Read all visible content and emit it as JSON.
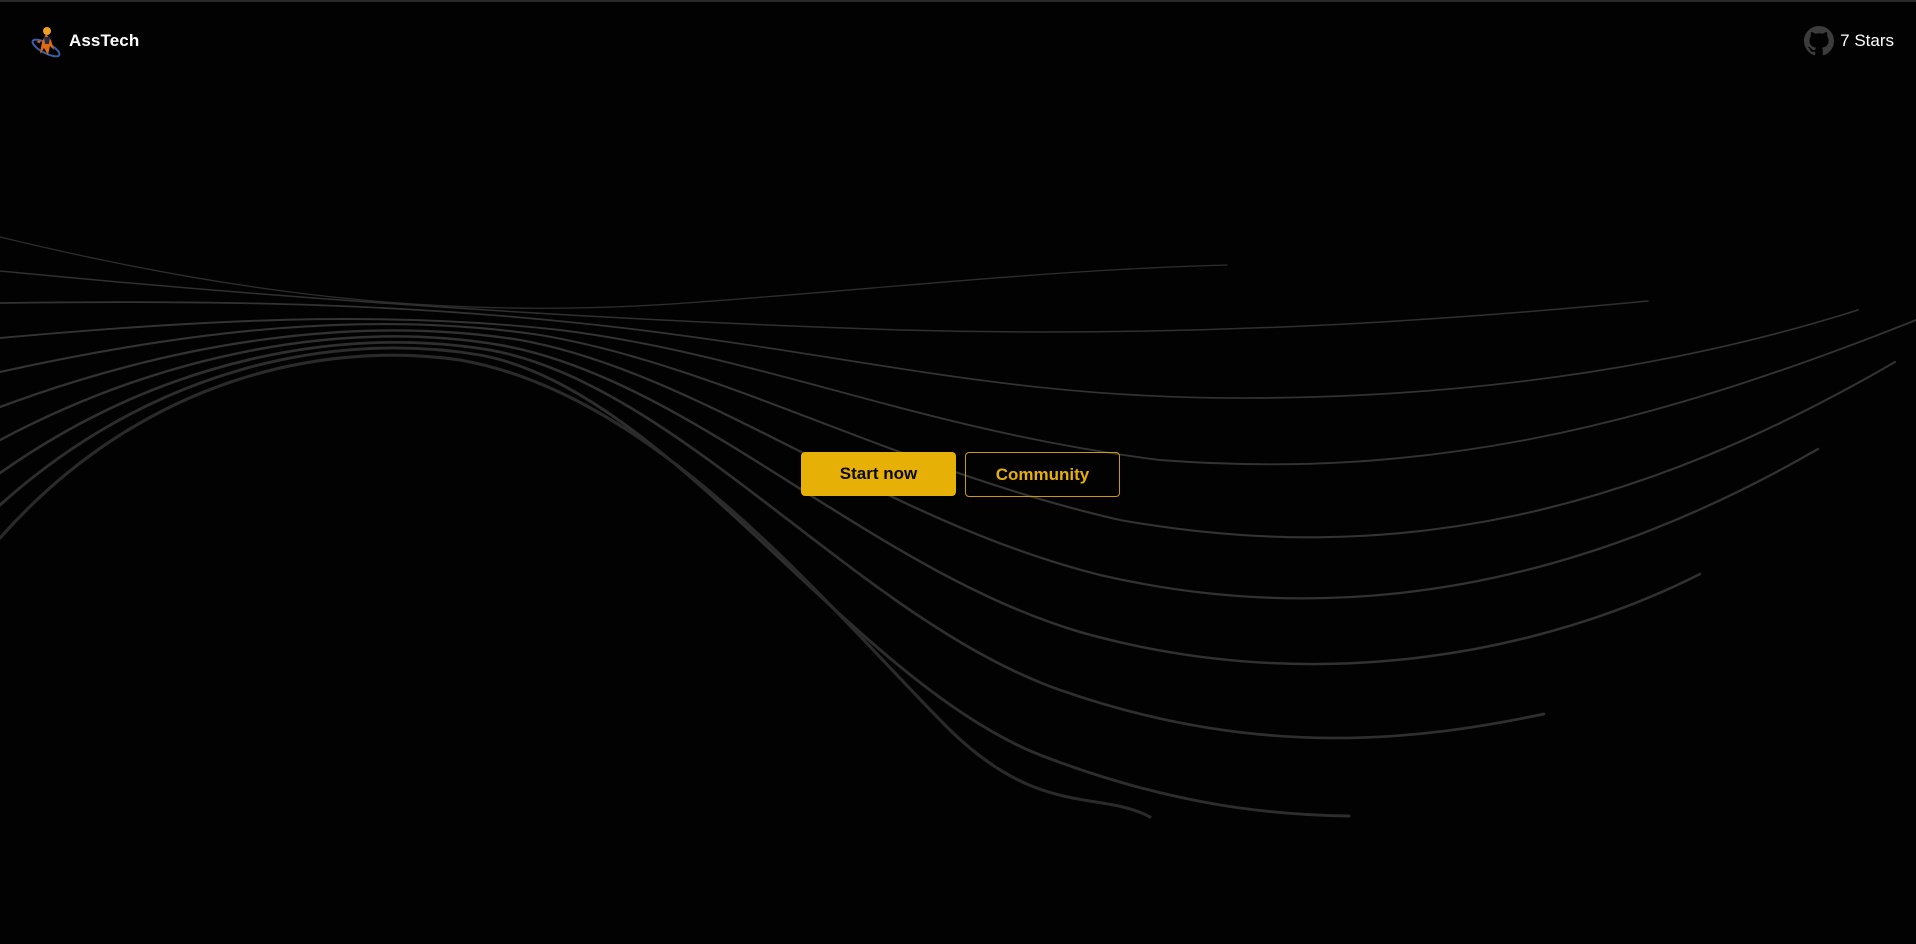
{
  "header": {
    "brand_name": "AssTech",
    "logo_icon": "astronaut-logo-icon",
    "github_icon": "github-icon",
    "stars_label": "7 Stars"
  },
  "hero": {
    "primary_label": "Start now",
    "secondary_label": "Community"
  },
  "colors": {
    "background": "#020202",
    "accent": "#e6b007",
    "line": "#3a3a3a",
    "text": "#ffffff"
  }
}
